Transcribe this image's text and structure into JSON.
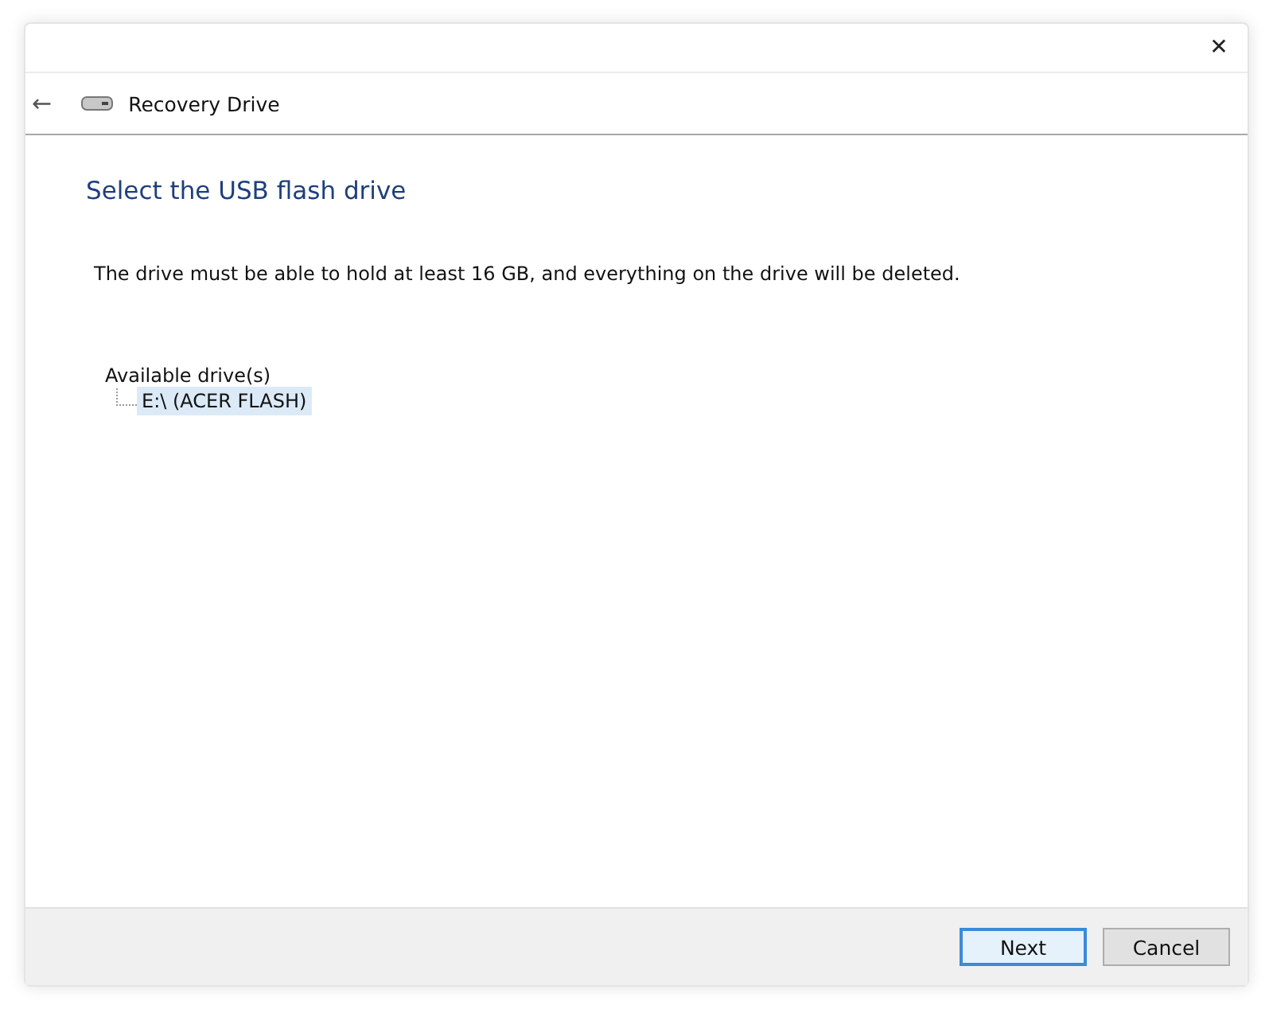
{
  "window": {
    "close": "✕"
  },
  "nav": {
    "back": "←",
    "title": "Recovery Drive"
  },
  "heading": "Select the USB flash drive",
  "description": "The drive must be able to hold at least 16 GB, and everything on the drive will be deleted.",
  "drives": {
    "label": "Available drive(s)",
    "items": [
      {
        "label": "E:\\ (ACER FLASH)",
        "selected": true
      }
    ]
  },
  "buttons": [
    {
      "label": "Next",
      "default": true
    },
    {
      "label": "Cancel",
      "default": false
    }
  ]
}
